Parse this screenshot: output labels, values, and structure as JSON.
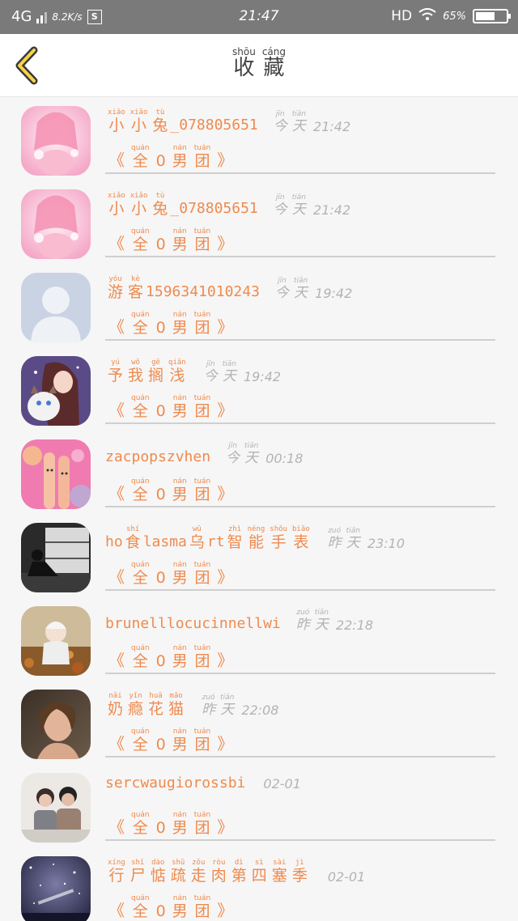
{
  "status_bar": {
    "network": "4G",
    "speed": "8.2K/s",
    "s_icon": "S",
    "time": "21:47",
    "hd": "HD",
    "battery": "65%",
    "battery_level": 0.65
  },
  "header": {
    "back_icon": "chevron-left-icon",
    "title": [
      {
        "pinyin": "shōu",
        "char": "收"
      },
      {
        "pinyin": "cáng",
        "char": "藏"
      }
    ]
  },
  "group_label": [
    {
      "pinyin": "quán",
      "char": "全"
    },
    {
      "pinyin": "",
      "char": "0"
    },
    {
      "pinyin": "nán",
      "char": "男"
    },
    {
      "pinyin": "tuán",
      "char": "团"
    }
  ],
  "brackets": {
    "open": "《",
    "close": "》"
  },
  "favorites": [
    {
      "avatar": "pink-anime-girl-avatar",
      "name": [
        {
          "pinyin": "xiǎo",
          "char": "小"
        },
        {
          "pinyin": "xiǎo",
          "char": "小"
        },
        {
          "pinyin": "tù",
          "char": "兔"
        },
        {
          "text": "_078805651"
        }
      ],
      "time_words": [
        {
          "pinyin": "jīn",
          "char": "今"
        },
        {
          "pinyin": "tiān",
          "char": "天"
        }
      ],
      "time": "21:42"
    },
    {
      "avatar": "pink-anime-girl-avatar",
      "name": [
        {
          "pinyin": "xiǎo",
          "char": "小"
        },
        {
          "pinyin": "xiǎo",
          "char": "小"
        },
        {
          "pinyin": "tù",
          "char": "兔"
        },
        {
          "text": "_078805651"
        }
      ],
      "time_words": [
        {
          "pinyin": "jīn",
          "char": "今"
        },
        {
          "pinyin": "tiān",
          "char": "天"
        }
      ],
      "time": "21:42"
    },
    {
      "avatar": "default-person-avatar",
      "name": [
        {
          "pinyin": "yóu",
          "char": "游"
        },
        {
          "pinyin": "kè",
          "char": "客"
        },
        {
          "text": "1596341010243"
        }
      ],
      "time_words": [
        {
          "pinyin": "jīn",
          "char": "今"
        },
        {
          "pinyin": "tiān",
          "char": "天"
        }
      ],
      "time": "19:42"
    },
    {
      "avatar": "girl-with-cat-avatar",
      "name": [
        {
          "pinyin": "yú",
          "char": "予"
        },
        {
          "pinyin": "wǒ",
          "char": "我"
        },
        {
          "pinyin": "gē",
          "char": "搁"
        },
        {
          "pinyin": "qiǎn",
          "char": "浅"
        }
      ],
      "time_words": [
        {
          "pinyin": "jīn",
          "char": "今"
        },
        {
          "pinyin": "tiān",
          "char": "天"
        }
      ],
      "time": "19:42"
    },
    {
      "avatar": "finger-puppets-avatar",
      "name": [
        {
          "text": "zacpopszvhen"
        }
      ],
      "time_words": [
        {
          "pinyin": "jīn",
          "char": "今"
        },
        {
          "pinyin": "tiān",
          "char": "天"
        }
      ],
      "time": "00:18"
    },
    {
      "avatar": "person-by-window-avatar",
      "name": [
        {
          "text": "ho"
        },
        {
          "pinyin": "shí",
          "char": "食"
        },
        {
          "text": "lasma"
        },
        {
          "pinyin": "wū",
          "char": "乌"
        },
        {
          "text": "rt"
        },
        {
          "pinyin": "zhì",
          "char": "智"
        },
        {
          "pinyin": "néng",
          "char": "能"
        },
        {
          "pinyin": "shǒu",
          "char": "手"
        },
        {
          "pinyin": "biǎo",
          "char": "表"
        }
      ],
      "time_words": [
        {
          "pinyin": "zuó",
          "char": "昨"
        },
        {
          "pinyin": "tiān",
          "char": "天"
        }
      ],
      "time": "23:10"
    },
    {
      "avatar": "baby-in-leaves-avatar",
      "name": [
        {
          "text": "brunelllocucinnellwi"
        }
      ],
      "time_words": [
        {
          "pinyin": "zuó",
          "char": "昨"
        },
        {
          "pinyin": "tiān",
          "char": "天"
        }
      ],
      "time": "22:18"
    },
    {
      "avatar": "woman-portrait-avatar",
      "name": [
        {
          "pinyin": "nǎi",
          "char": "奶"
        },
        {
          "pinyin": "yǐn",
          "char": "瘾"
        },
        {
          "pinyin": "huā",
          "char": "花"
        },
        {
          "pinyin": "māo",
          "char": "猫"
        }
      ],
      "time_words": [
        {
          "pinyin": "zuó",
          "char": "昨"
        },
        {
          "pinyin": "tiān",
          "char": "天"
        }
      ],
      "time": "22:08"
    },
    {
      "avatar": "couple-photo-avatar",
      "name": [
        {
          "text": "sercwaugiorossbi"
        }
      ],
      "time_words": [],
      "time": "02-01"
    },
    {
      "avatar": "starry-night-avatar",
      "name": [
        {
          "pinyin": "xíng",
          "char": "行"
        },
        {
          "pinyin": "shī",
          "char": "尸"
        },
        {
          "pinyin": "dào",
          "char": "惦"
        },
        {
          "pinyin": "shū",
          "char": "疏"
        },
        {
          "pinyin": "zǒu",
          "char": "走"
        },
        {
          "pinyin": "ròu",
          "char": "肉"
        },
        {
          "pinyin": "dì",
          "char": "第"
        },
        {
          "pinyin": "sì",
          "char": "四"
        },
        {
          "pinyin": "sài",
          "char": "塞"
        },
        {
          "pinyin": "jì",
          "char": "季"
        }
      ],
      "time_words": [],
      "time": "02-01"
    }
  ]
}
